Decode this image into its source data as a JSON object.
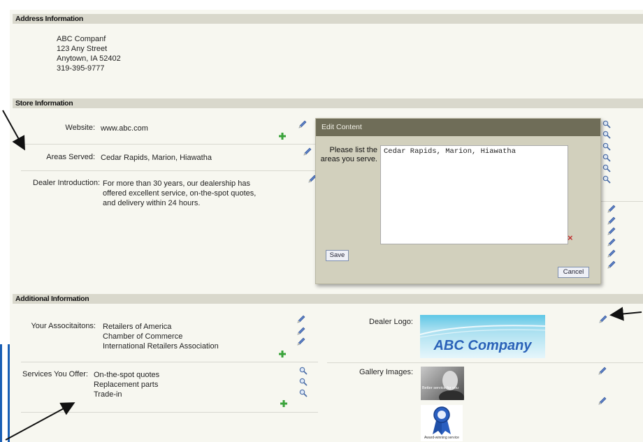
{
  "address_section": {
    "header": "Address Information",
    "lines": [
      "ABC Companf",
      "123 Any Street",
      "Anytown, IA 52402",
      "319-395-9777"
    ]
  },
  "store_section": {
    "header": "Store Information",
    "website_label": "Website:",
    "website_value": "www.abc.com",
    "areas_label": "Areas Served:",
    "areas_value": "Cedar Rapids, Marion, Hiawatha",
    "intro_label": "Dealer Introduction:",
    "intro_lines": [
      "For more than 30 years, our dealership has",
      "offered excellent service, on-the-spot quotes,",
      "and delivery within 24 hours."
    ]
  },
  "dialog": {
    "title": "Edit Content",
    "prompt_lines": [
      "Please list the",
      "areas you serve."
    ],
    "textarea_value": "Cedar Rapids, Marion, Hiawatha",
    "save_label": "Save",
    "cancel_label": "Cancel",
    "clear_symbol": "×"
  },
  "additional_section": {
    "header": "Additional Information",
    "assoc_label": "Your Associtaitons:",
    "assoc_items": [
      "Retailers of America",
      "Chamber of Commerce",
      "International Retailers Association"
    ],
    "services_label": "Services You Offer:",
    "services_items": [
      "On-the-spot quotes",
      "Replacement parts",
      "Trade-in"
    ],
    "logo_label": "Dealer Logo:",
    "logo_text": "ABC Company",
    "gallery_label": "Gallery Images:",
    "gallery_caption_1": "Better service for you",
    "gallery_caption_2": "Award-winning service"
  },
  "icons": {
    "pencil": "pencil-icon",
    "magnifier": "magnifier-icon",
    "add": "plus-icon"
  },
  "colors": {
    "header_bg": "#d9d8cc",
    "dialog_title_bg": "#6f6d58",
    "dialog_bg": "#d2d0bd",
    "accent_blue": "#2a62b8",
    "plus_green": "#3aa33a"
  }
}
